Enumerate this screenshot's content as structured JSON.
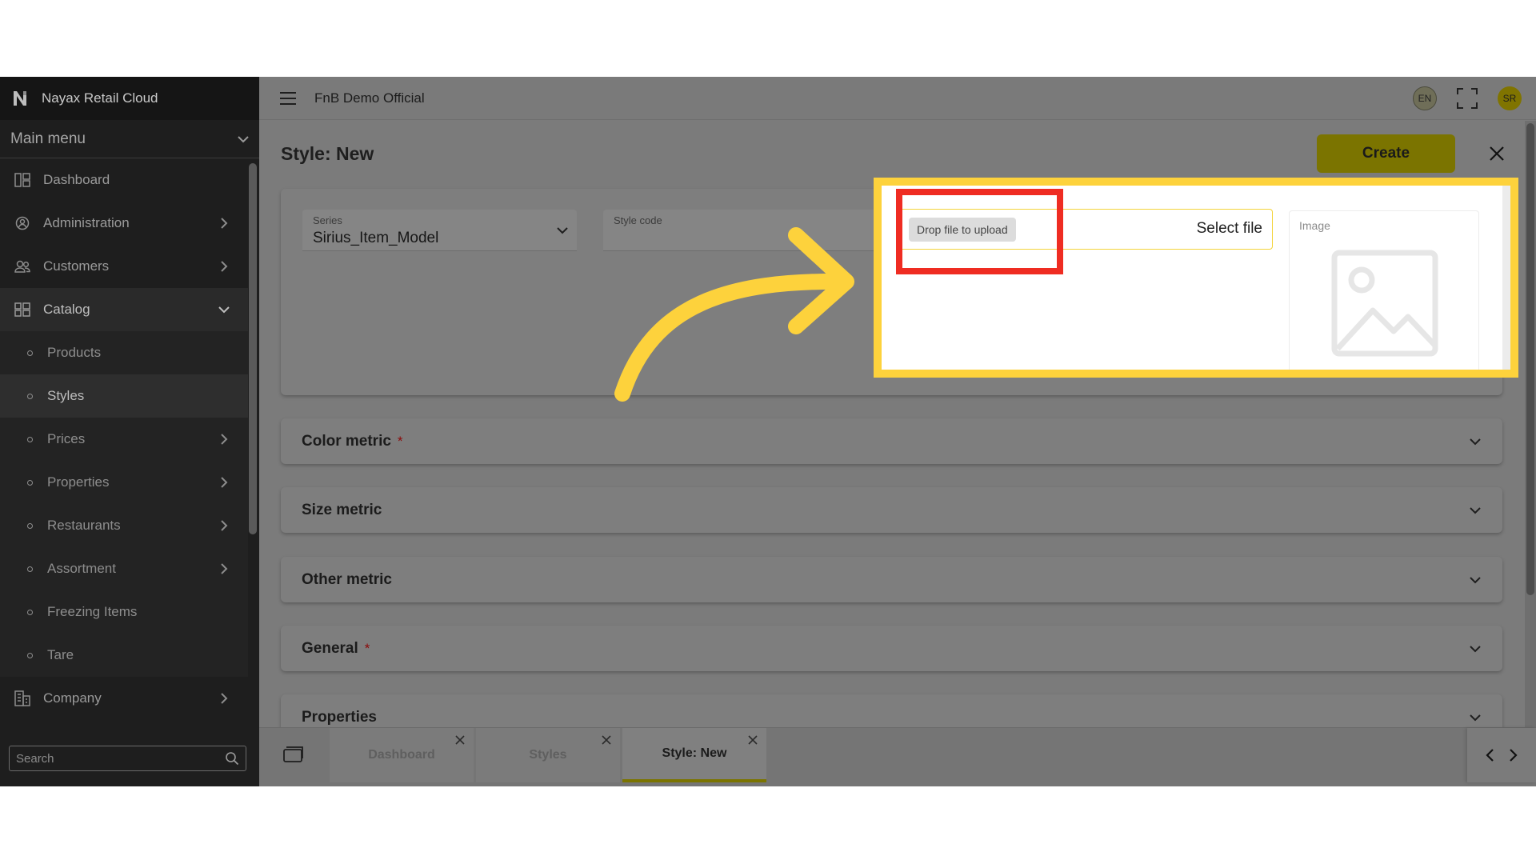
{
  "brand": {
    "name": "Nayax Retail Cloud"
  },
  "menu": {
    "title": "Main menu"
  },
  "sidebar": {
    "items": [
      {
        "label": "Dashboard"
      },
      {
        "label": "Administration"
      },
      {
        "label": "Customers"
      },
      {
        "label": "Catalog"
      },
      {
        "label": "Company"
      }
    ],
    "catalog_sub": [
      {
        "label": "Products"
      },
      {
        "label": "Styles"
      },
      {
        "label": "Prices"
      },
      {
        "label": "Properties"
      },
      {
        "label": "Restaurants"
      },
      {
        "label": "Assortment"
      },
      {
        "label": "Freezing Items"
      },
      {
        "label": "Tare"
      }
    ],
    "search_placeholder": "Search"
  },
  "header": {
    "org": "FnB Demo Official",
    "lang": "EN",
    "avatar": "SR"
  },
  "page": {
    "title": "Style: New",
    "create_label": "Create"
  },
  "form": {
    "series_label": "Series",
    "series_value": "Sirius_Item_Model",
    "style_code_label": "Style code",
    "drop_label": "Drop file to upload",
    "select_label": "Select file",
    "image_label": "Image"
  },
  "sections": [
    {
      "title": "Color metric",
      "required": "*"
    },
    {
      "title": "Size metric",
      "required": ""
    },
    {
      "title": "Other metric",
      "required": ""
    },
    {
      "title": "General",
      "required": "*"
    },
    {
      "title": "Properties",
      "required": ""
    }
  ],
  "tabs": [
    {
      "label": "Dashboard"
    },
    {
      "label": "Styles"
    },
    {
      "label": "Style: New"
    }
  ],
  "colors": {
    "accent": "#7b7400",
    "highlight": "#fdd23c",
    "callout": "#ef2c22",
    "arrow": "#fdd23c"
  }
}
